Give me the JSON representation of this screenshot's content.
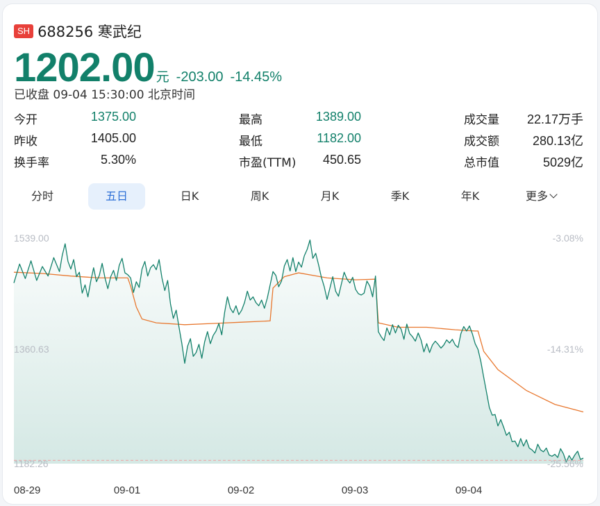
{
  "quote": {
    "exchange_badge": "SH",
    "title": "688256 寒武纪",
    "price": "1202.00",
    "unit": "元",
    "change": "-203.00",
    "change_pct": "-14.45%",
    "status": "已收盘 09-04 15:30:00 北京时间"
  },
  "stats": [
    {
      "label": "今开",
      "value": "1375.00",
      "color": "green"
    },
    {
      "label": "最高",
      "value": "1389.00",
      "color": "green"
    },
    {
      "label": "成交量",
      "value": "22.17万手",
      "color": "dark"
    },
    {
      "label": "昨收",
      "value": "1405.00",
      "color": "dark"
    },
    {
      "label": "最低",
      "value": "1182.00",
      "color": "green"
    },
    {
      "label": "成交额",
      "value": "280.13亿",
      "color": "dark"
    },
    {
      "label": "换手率",
      "value": "5.30%",
      "color": "dark"
    },
    {
      "label": "市盈(TTM)",
      "value": "450.65",
      "color": "dark"
    },
    {
      "label": "总市值",
      "value": "5029亿",
      "color": "dark"
    }
  ],
  "tabs": [
    "分时",
    "五日",
    "日K",
    "周K",
    "月K",
    "季K",
    "年K",
    "更多"
  ],
  "active_tab": "五日",
  "colors": {
    "down": "#12806a",
    "up": "#e8403a",
    "avg_line": "#e8772e",
    "active_tab": "#2d6fd6"
  },
  "chart_data": {
    "type": "line",
    "title": "",
    "y_left_ticks": [
      "1539.00",
      "1360.63",
      "1182.26"
    ],
    "y_right_ticks": [
      "-3.08%",
      "-14.31%",
      "-25.56%"
    ],
    "x_ticks": [
      "08-29",
      "09-01",
      "09-02",
      "09-03",
      "09-04"
    ],
    "ylim": [
      1182.26,
      1539.0
    ],
    "prev_close_ref": 1187.5,
    "series": [
      {
        "name": "price",
        "values": [
          [
            0,
            1468
          ],
          [
            2,
            1498
          ],
          [
            4,
            1475
          ],
          [
            6,
            1503
          ],
          [
            8,
            1472
          ],
          [
            10,
            1494
          ],
          [
            12,
            1479
          ],
          [
            14,
            1508
          ],
          [
            16,
            1486
          ],
          [
            17,
            1512
          ],
          [
            18,
            1530
          ],
          [
            19,
            1502
          ],
          [
            20,
            1490
          ],
          [
            21,
            1505
          ],
          [
            22,
            1478
          ],
          [
            23,
            1485
          ],
          [
            24,
            1452
          ],
          [
            25,
            1465
          ],
          [
            26,
            1446
          ],
          [
            27,
            1471
          ],
          [
            28,
            1492
          ],
          [
            29,
            1470
          ],
          [
            30,
            1480
          ],
          [
            31,
            1499
          ],
          [
            32,
            1476
          ],
          [
            33,
            1459
          ],
          [
            34,
            1478
          ],
          [
            35,
            1488
          ],
          [
            36,
            1472
          ],
          [
            37,
            1496
          ],
          [
            38,
            1507
          ],
          [
            39,
            1484
          ],
          [
            40,
            1481
          ],
          [
            41,
            1476
          ],
          [
            42,
            1453
          ],
          [
            43,
            1470
          ],
          [
            44,
            1461
          ],
          [
            45,
            1490
          ],
          [
            46,
            1502
          ],
          [
            47,
            1479
          ],
          [
            48,
            1492
          ],
          [
            49,
            1497
          ],
          [
            50,
            1489
          ],
          [
            51,
            1505
          ],
          [
            52,
            1476
          ],
          [
            53,
            1456
          ],
          [
            54,
            1472
          ],
          [
            55,
            1435
          ],
          [
            56,
            1412
          ],
          [
            57,
            1425
          ],
          [
            58,
            1398
          ],
          [
            59,
            1372
          ],
          [
            60,
            1341
          ],
          [
            61,
            1368
          ],
          [
            62,
            1380
          ],
          [
            63,
            1352
          ],
          [
            64,
            1358
          ],
          [
            65,
            1371
          ],
          [
            66,
            1349
          ],
          [
            67,
            1375
          ],
          [
            68,
            1391
          ],
          [
            69,
            1372
          ],
          [
            70,
            1385
          ],
          [
            71,
            1392
          ],
          [
            72,
            1404
          ],
          [
            73,
            1386
          ],
          [
            74,
            1421
          ],
          [
            75,
            1446
          ],
          [
            76,
            1428
          ],
          [
            77,
            1421
          ],
          [
            78,
            1432
          ],
          [
            79,
            1418
          ],
          [
            80,
            1425
          ],
          [
            81,
            1437
          ],
          [
            82,
            1455
          ],
          [
            83,
            1441
          ],
          [
            84,
            1446
          ],
          [
            85,
            1437
          ],
          [
            86,
            1432
          ],
          [
            87,
            1441
          ],
          [
            88,
            1428
          ],
          [
            89,
            1444
          ],
          [
            90,
            1465
          ],
          [
            91,
            1486
          ],
          [
            92,
            1480
          ],
          [
            93,
            1462
          ],
          [
            94,
            1471
          ],
          [
            95,
            1495
          ],
          [
            96,
            1505
          ],
          [
            97,
            1487
          ],
          [
            98,
            1508
          ],
          [
            99,
            1486
          ],
          [
            100,
            1501
          ],
          [
            101,
            1493
          ],
          [
            102,
            1511
          ],
          [
            103,
            1521
          ],
          [
            104,
            1536
          ],
          [
            105,
            1507
          ],
          [
            106,
            1515
          ],
          [
            107,
            1497
          ],
          [
            108,
            1477
          ],
          [
            109,
            1462
          ],
          [
            110,
            1442
          ],
          [
            111,
            1460
          ],
          [
            112,
            1478
          ],
          [
            113,
            1455
          ],
          [
            114,
            1447
          ],
          [
            115,
            1466
          ],
          [
            116,
            1485
          ],
          [
            117,
            1474
          ],
          [
            118,
            1468
          ],
          [
            119,
            1477
          ],
          [
            120,
            1458
          ],
          [
            121,
            1451
          ],
          [
            122,
            1449
          ],
          [
            123,
            1452
          ],
          [
            124,
            1471
          ],
          [
            125,
            1463
          ],
          [
            126,
            1446
          ],
          [
            127,
            1479
          ],
          [
            128,
            1391
          ],
          [
            129,
            1383
          ],
          [
            130,
            1377
          ],
          [
            131,
            1397
          ],
          [
            132,
            1386
          ],
          [
            133,
            1402
          ],
          [
            134,
            1389
          ],
          [
            135,
            1401
          ],
          [
            136,
            1395
          ],
          [
            137,
            1379
          ],
          [
            138,
            1403
          ],
          [
            139,
            1388
          ],
          [
            140,
            1383
          ],
          [
            141,
            1376
          ],
          [
            142,
            1389
          ],
          [
            143,
            1378
          ],
          [
            144,
            1359
          ],
          [
            145,
            1372
          ],
          [
            146,
            1358
          ],
          [
            147,
            1370
          ],
          [
            148,
            1376
          ],
          [
            149,
            1371
          ],
          [
            150,
            1365
          ],
          [
            151,
            1370
          ],
          [
            152,
            1378
          ],
          [
            153,
            1373
          ],
          [
            154,
            1379
          ],
          [
            155,
            1370
          ],
          [
            156,
            1366
          ],
          [
            157,
            1388
          ],
          [
            158,
            1399
          ],
          [
            159,
            1392
          ],
          [
            160,
            1400
          ],
          [
            161,
            1388
          ],
          [
            162,
            1372
          ],
          [
            163,
            1363
          ],
          [
            164,
            1344
          ],
          [
            165,
            1319
          ],
          [
            166,
            1295
          ],
          [
            167,
            1271
          ],
          [
            168,
            1259
          ],
          [
            169,
            1260
          ],
          [
            170,
            1242
          ],
          [
            171,
            1252
          ],
          [
            172,
            1240
          ],
          [
            173,
            1227
          ],
          [
            174,
            1232
          ],
          [
            175,
            1217
          ],
          [
            176,
            1218
          ],
          [
            177,
            1209
          ],
          [
            178,
            1222
          ],
          [
            179,
            1210
          ],
          [
            180,
            1220
          ],
          [
            181,
            1207
          ],
          [
            182,
            1204
          ],
          [
            183,
            1199
          ],
          [
            184,
            1213
          ],
          [
            185,
            1204
          ],
          [
            186,
            1201
          ],
          [
            187,
            1207
          ],
          [
            188,
            1196
          ],
          [
            189,
            1194
          ],
          [
            190,
            1197
          ],
          [
            191,
            1192
          ],
          [
            192,
            1206
          ],
          [
            193,
            1198
          ],
          [
            194,
            1185
          ],
          [
            195,
            1195
          ],
          [
            196,
            1188
          ],
          [
            197,
            1196
          ],
          [
            198,
            1202
          ],
          [
            199,
            1189
          ],
          [
            200,
            1191
          ]
        ]
      },
      {
        "name": "average",
        "values": [
          [
            0,
            1485
          ],
          [
            10,
            1483
          ],
          [
            20,
            1479
          ],
          [
            30,
            1476
          ],
          [
            40,
            1476
          ],
          [
            41,
            1463
          ],
          [
            43,
            1430
          ],
          [
            45,
            1411
          ],
          [
            50,
            1405
          ],
          [
            60,
            1402
          ],
          [
            70,
            1404
          ],
          [
            80,
            1406
          ],
          [
            90,
            1408
          ],
          [
            91,
            1460
          ],
          [
            95,
            1478
          ],
          [
            100,
            1484
          ],
          [
            110,
            1476
          ],
          [
            120,
            1473
          ],
          [
            127,
            1474
          ],
          [
            128,
            1405
          ],
          [
            135,
            1398
          ],
          [
            145,
            1398
          ],
          [
            155,
            1394
          ],
          [
            162,
            1392
          ],
          [
            163,
            1392
          ],
          [
            165,
            1360
          ],
          [
            170,
            1331
          ],
          [
            180,
            1298
          ],
          [
            190,
            1276
          ],
          [
            200,
            1264
          ]
        ]
      }
    ],
    "grid": false,
    "legend": "none"
  }
}
